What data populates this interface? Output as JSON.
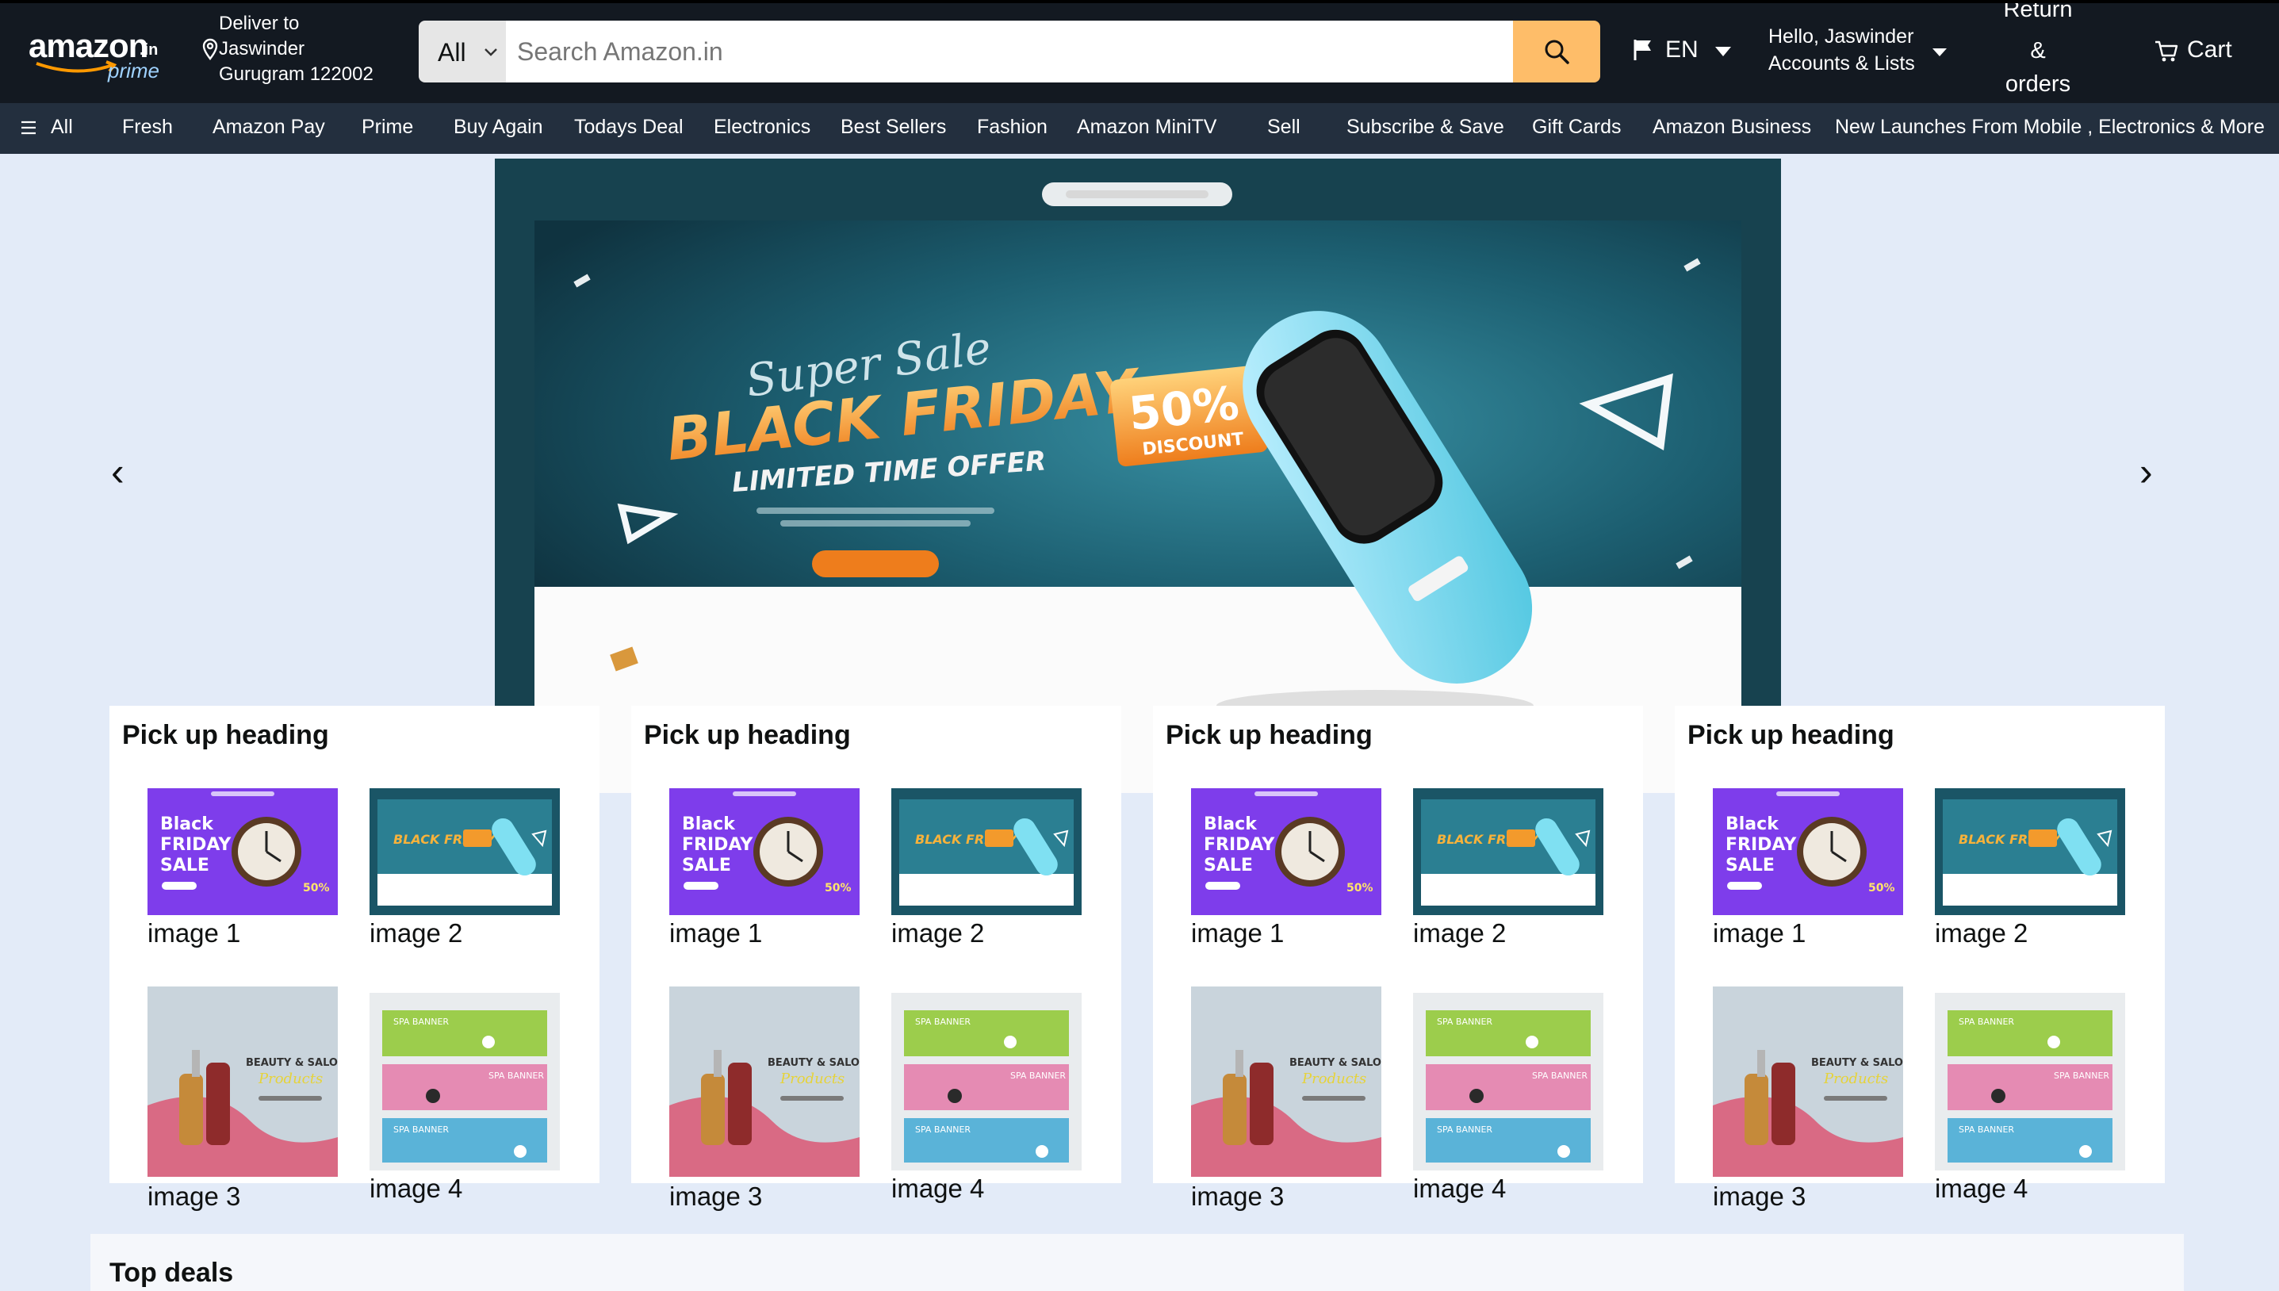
{
  "header": {
    "logo": {
      "word": "amazon",
      "tld": ".in",
      "sub": "prime"
    },
    "deliver": {
      "line1": "Deliver to",
      "line2": "Jaswinder",
      "line3": "Gurugram 122002"
    },
    "search": {
      "category": "All",
      "placeholder": "Search Amazon.in",
      "value": ""
    },
    "language": "EN",
    "account": {
      "line1": "Hello, Jaswinder",
      "line2": "Accounts & Lists"
    },
    "returns": {
      "line1": "Return",
      "line2": "&",
      "line3": "orders"
    },
    "cart": "Cart",
    "colors": {
      "bar": "#131921",
      "search_button": "#febd69"
    }
  },
  "nav": {
    "all": "All",
    "items": [
      "Fresh",
      "Amazon Pay",
      "Prime",
      "Buy Again",
      "Todays Deal",
      "Electronics",
      "Best Sellers",
      "Fashion",
      "Amazon MiniTV",
      "Sell",
      "Subscribe & Save",
      "Gift Cards",
      "Amazon Business",
      "New Launches From Mobile , Electronics & More"
    ]
  },
  "hero": {
    "prev": "‹",
    "next": "›",
    "badge_line1": "Super Sale",
    "badge_line2": "BLACK FRIDAY",
    "badge_line3": "LIMITED TIME OFFER",
    "discount": "50%",
    "discount_sub": "DISCOUNT"
  },
  "pickup_cards": [
    {
      "heading": "Pick up heading",
      "images": [
        "image 1",
        "image 2",
        "image 3",
        "image 4"
      ]
    },
    {
      "heading": "Pick up heading",
      "images": [
        "image 1",
        "image 2",
        "image 3",
        "image 4"
      ]
    },
    {
      "heading": "Pick up heading",
      "images": [
        "image 1",
        "image 2",
        "image 3",
        "image 4"
      ]
    },
    {
      "heading": "Pick up heading",
      "images": [
        "image 1",
        "image 2",
        "image 3",
        "image 4"
      ]
    }
  ],
  "thumb_text": {
    "watch_sale": "Black FRIDAY SALE",
    "beauty": "BEAUTY & SALOON",
    "spa": "SPA BANNER"
  },
  "top_deals": {
    "heading": "Top deals"
  }
}
